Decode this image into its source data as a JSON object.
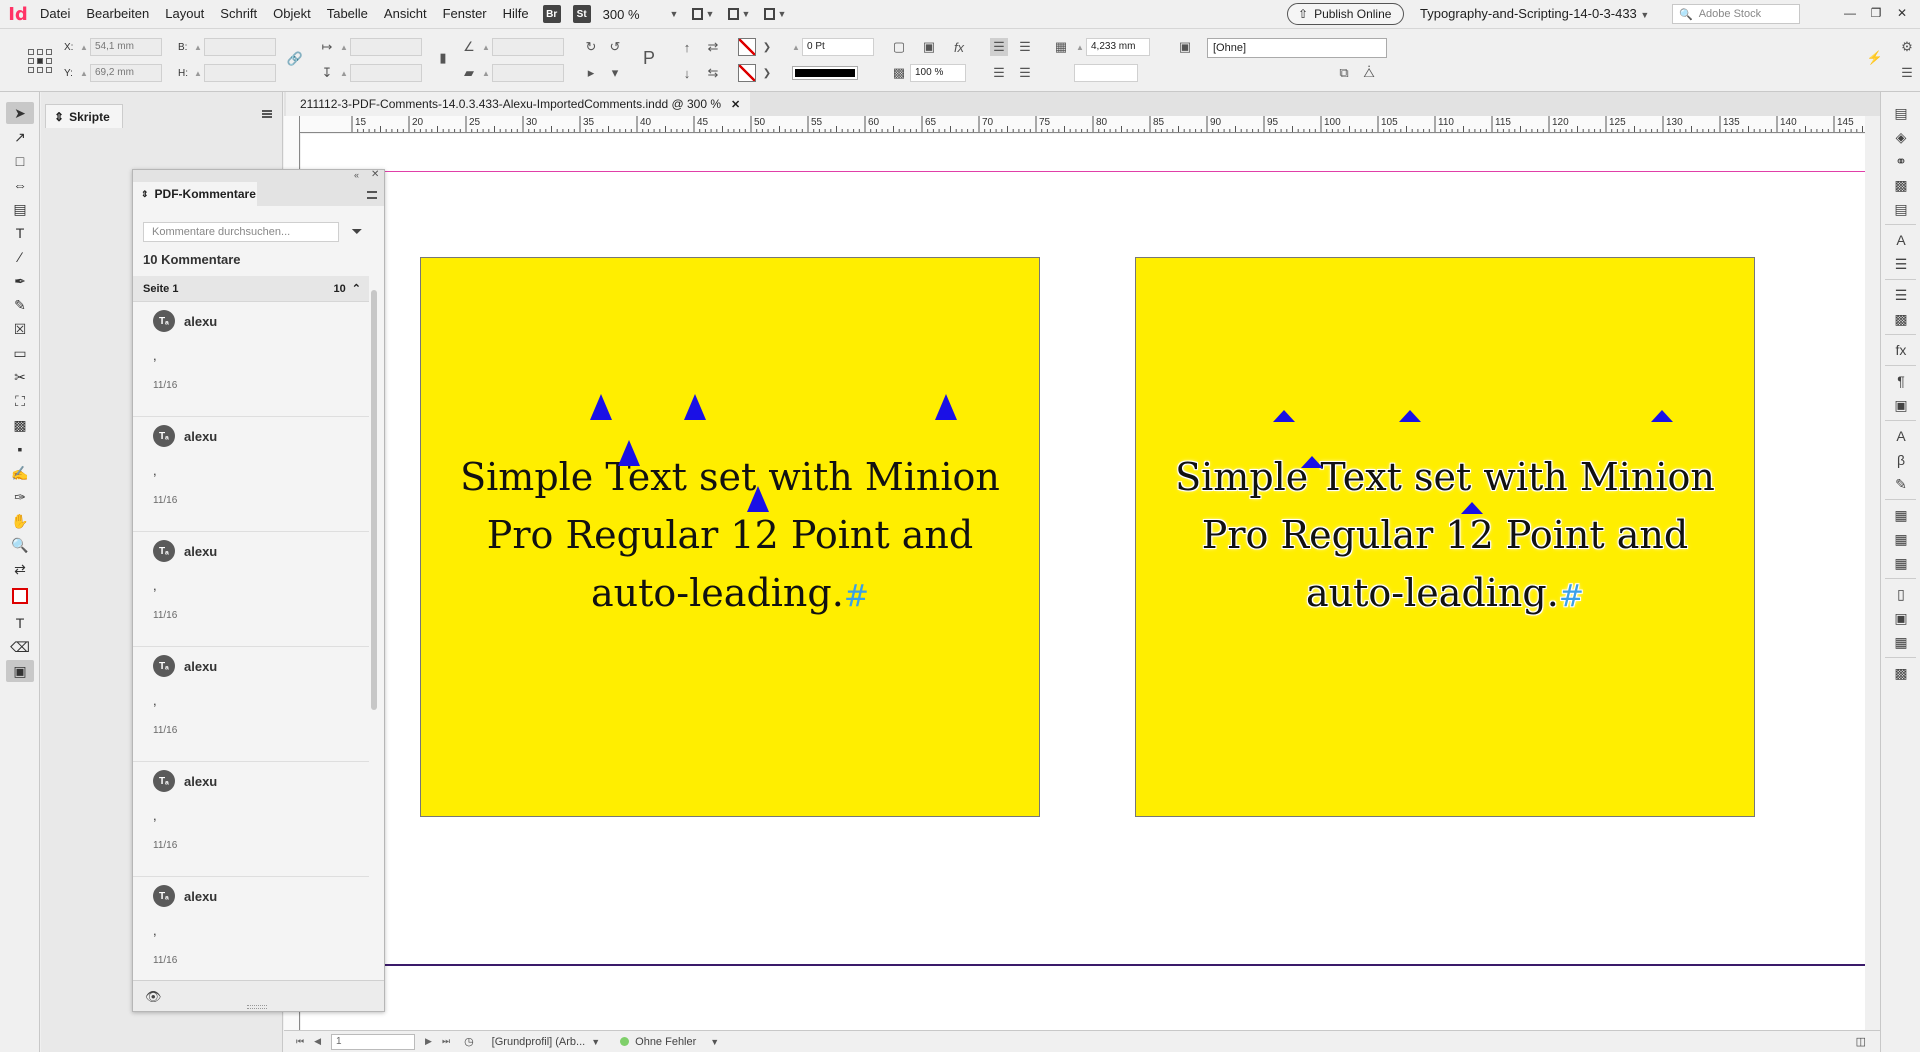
{
  "app": {
    "logo": "Id"
  },
  "menu": {
    "items": [
      "Datei",
      "Bearbeiten",
      "Layout",
      "Schrift",
      "Objekt",
      "Tabelle",
      "Ansicht",
      "Fenster",
      "Hilfe"
    ],
    "bridge_badge": "Br",
    "stock_badge": "St",
    "zoom": "300 %"
  },
  "publish": {
    "label": "Publish Online"
  },
  "workspace": {
    "name": "Typography-and-Scripting-14-0-3-433"
  },
  "stock_search": {
    "placeholder": "Adobe Stock"
  },
  "control": {
    "x_label": "X:",
    "x_value": "54,1 mm",
    "y_label": "Y:",
    "y_value": "69,2 mm",
    "w_label": "B:",
    "h_label": "H:",
    "stroke_weight": "0 Pt",
    "opacity": "100 %",
    "gutter": "4,233 mm",
    "object_style": "[Ohne]"
  },
  "dock": {
    "scripts_tab": "Skripte"
  },
  "document": {
    "tab_title": "211112-3-PDF-Comments-14.0.3.433-Alexu-ImportedComments.indd @ 300 %",
    "ruler_ticks": [
      "15",
      "20",
      "25",
      "30",
      "35",
      "40",
      "45",
      "50",
      "55",
      "60",
      "65",
      "70",
      "75",
      "80",
      "85",
      "90",
      "95",
      "100",
      "105",
      "110",
      "115",
      "120",
      "125",
      "130",
      "135",
      "140",
      "145"
    ],
    "frames": [
      {
        "text": "Simple Text set with Minion Pro Regular 12 Point and auto-leading.",
        "end_mark": "#"
      },
      {
        "text": "Simple Text set with Minion Pro Regular 12 Point and auto-leading.",
        "end_mark": "#"
      }
    ],
    "frame_color": "#ffee00",
    "marker_color": "#1a10e6"
  },
  "status": {
    "page": "1",
    "profile": "[Grundprofil] (Arb...",
    "preflight": "Ohne Fehler"
  },
  "pdf_panel": {
    "title": "PDF-Kommentare",
    "search_placeholder": "Kommentare durchsuchen...",
    "count_label": "10 Kommentare",
    "group": {
      "label": "Seite 1",
      "count": "10"
    },
    "comments": [
      {
        "author": "alexu",
        "text": ",",
        "date": "11/16"
      },
      {
        "author": "alexu",
        "text": ",",
        "date": "11/16"
      },
      {
        "author": "alexu",
        "text": ",",
        "date": "11/16"
      },
      {
        "author": "alexu",
        "text": ",",
        "date": "11/16"
      },
      {
        "author": "alexu",
        "text": ",",
        "date": "11/16"
      },
      {
        "author": "alexu",
        "text": ",",
        "date": "11/16"
      }
    ]
  }
}
